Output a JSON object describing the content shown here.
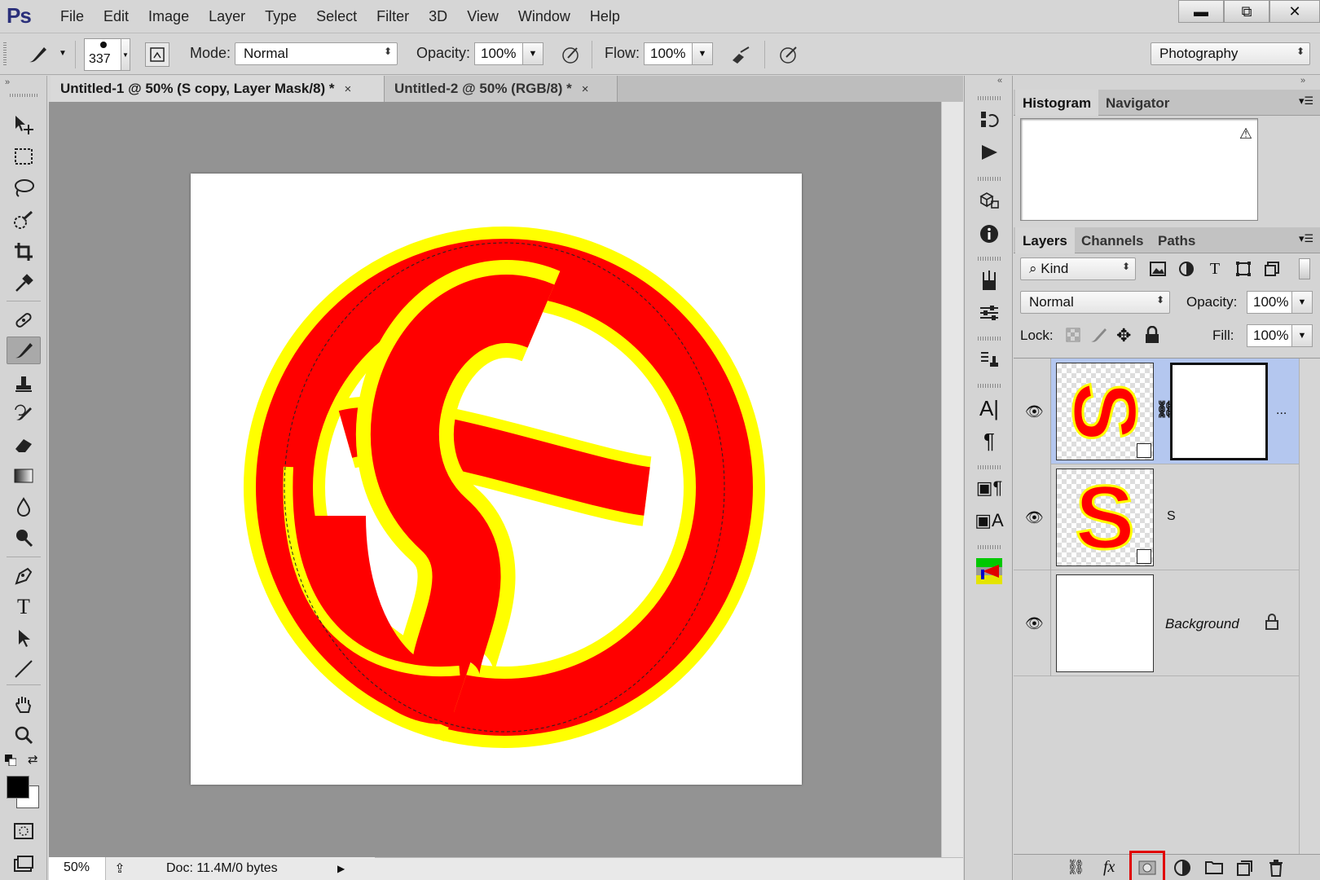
{
  "app": {
    "logo": "Ps"
  },
  "menu": [
    "File",
    "Edit",
    "Image",
    "Layer",
    "Type",
    "Select",
    "Filter",
    "3D",
    "View",
    "Window",
    "Help"
  ],
  "window_controls": {
    "minimize": "▬",
    "restore": "⧉",
    "close": "✕"
  },
  "options": {
    "brush_size": "337",
    "mode_label": "Mode:",
    "mode_value": "Normal",
    "opacity_label": "Opacity:",
    "opacity_value": "100%",
    "flow_label": "Flow:",
    "flow_value": "100%",
    "workspace": "Photography"
  },
  "tabs": [
    {
      "label": "Untitled-1 @ 50% (S copy, Layer Mask/8) *",
      "close": "×"
    },
    {
      "label": "Untitled-2 @ 50% (RGB/8) *",
      "close": "×"
    }
  ],
  "status": {
    "zoom": "50%",
    "doc_info": "Doc: 11.4M/0 bytes"
  },
  "panels": {
    "top_tabs": [
      "Histogram",
      "Navigator"
    ],
    "layer_tabs": [
      "Layers",
      "Channels",
      "Paths"
    ],
    "filter_kind": "Kind",
    "blend_mode": "Normal",
    "opacity_label": "Opacity:",
    "opacity_value": "100%",
    "lock_label": "Lock:",
    "fill_label": "Fill:",
    "fill_value": "100%"
  },
  "layers": [
    {
      "name": "",
      "thumb_letter": "S",
      "has_mask": true,
      "selected": true,
      "more": "..."
    },
    {
      "name": "S",
      "thumb_letter": "S",
      "has_mask": false,
      "selected": false
    },
    {
      "name": "Background",
      "thumb_letter": "",
      "has_mask": false,
      "selected": false,
      "locked": true
    }
  ],
  "colors": {
    "accent_red": "#ff0000",
    "accent_yellow": "#ffff00",
    "selection_blue": "#b4c7ef",
    "highlight_box": "#e00000",
    "logo": "#2a2f7a"
  }
}
